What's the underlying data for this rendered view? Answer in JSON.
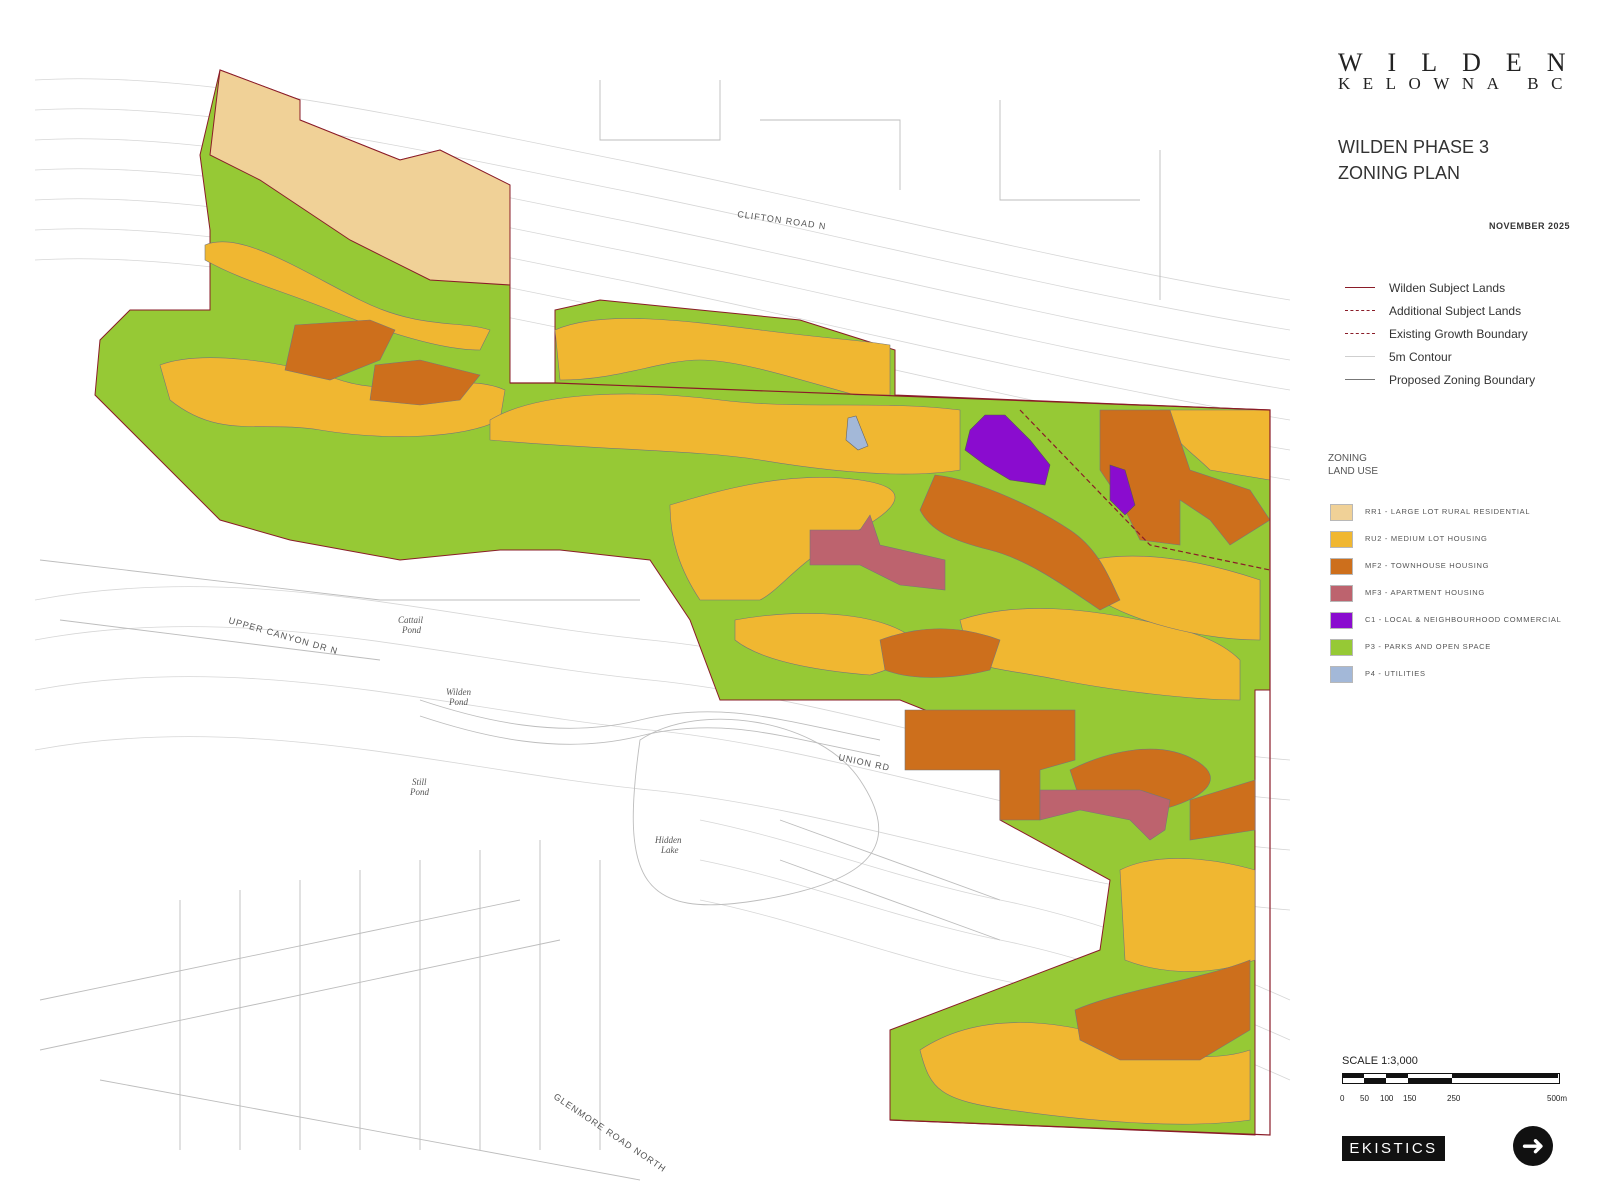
{
  "header": {
    "brand": "WILDEN",
    "location": "KELOWNA BC",
    "title_line1": "WILDEN PHASE 3",
    "title_line2": "ZONING PLAN",
    "date": "NOVEMBER 2025"
  },
  "line_legend": [
    {
      "label": "Wilden Subject Lands",
      "color": "#8a1c28",
      "style": "solid"
    },
    {
      "label": "Additional Subject Lands",
      "color": "#8a1c28",
      "style": "dash-dot"
    },
    {
      "label": "Existing Growth Boundary",
      "color": "#8a1c28",
      "style": "dashed"
    },
    {
      "label": "5m Contour",
      "color": "#cfcfcf",
      "style": "solid"
    },
    {
      "label": "Proposed Zoning Boundary",
      "color": "#777777",
      "style": "solid"
    }
  ],
  "zoning": {
    "heading_line1": "ZONING",
    "heading_line2": "LAND USE",
    "items": [
      {
        "code": "RR1",
        "label": "RR1 - LARGE LOT RURAL RESIDENTIAL",
        "color": "#f0d197"
      },
      {
        "code": "RU2",
        "label": "RU2 - MEDIUM LOT HOUSING",
        "color": "#f0b731"
      },
      {
        "code": "MF2",
        "label": "MF2 - TOWNHOUSE HOUSING",
        "color": "#cd6f1c"
      },
      {
        "code": "MF3",
        "label": "MF3 - APARTMENT HOUSING",
        "color": "#bd636e"
      },
      {
        "code": "C1",
        "label": "C1 - LOCAL & NEIGHBOURHOOD COMMERCIAL",
        "color": "#8a0ccf"
      },
      {
        "code": "P3",
        "label": "P3 - PARKS AND OPEN SPACE",
        "color": "#96c935"
      },
      {
        "code": "P4",
        "label": "P4 - UTILITIES",
        "color": "#a3b8d8"
      }
    ]
  },
  "map_labels": {
    "clifton": "CLIFTON ROAD N",
    "upper_canyon": "UPPER CANYON DR N",
    "union": "UNION RD",
    "glenmore": "GLENMORE ROAD NORTH",
    "cattail_1": "Cattail",
    "cattail_2": "Pond",
    "wilden_pond_1": "Wilden",
    "wilden_pond_2": "Pond",
    "still_pond_1": "Still",
    "still_pond_2": "Pond",
    "hidden_lake_1": "Hidden",
    "hidden_lake_2": "Lake"
  },
  "scale": {
    "label": "SCALE 1:3,000",
    "ticks": [
      "0",
      "50",
      "100",
      "150",
      "250",
      "500m"
    ]
  },
  "footer": {
    "logo": "EKISTICS",
    "arrow_icon": "arrow-right-icon"
  }
}
